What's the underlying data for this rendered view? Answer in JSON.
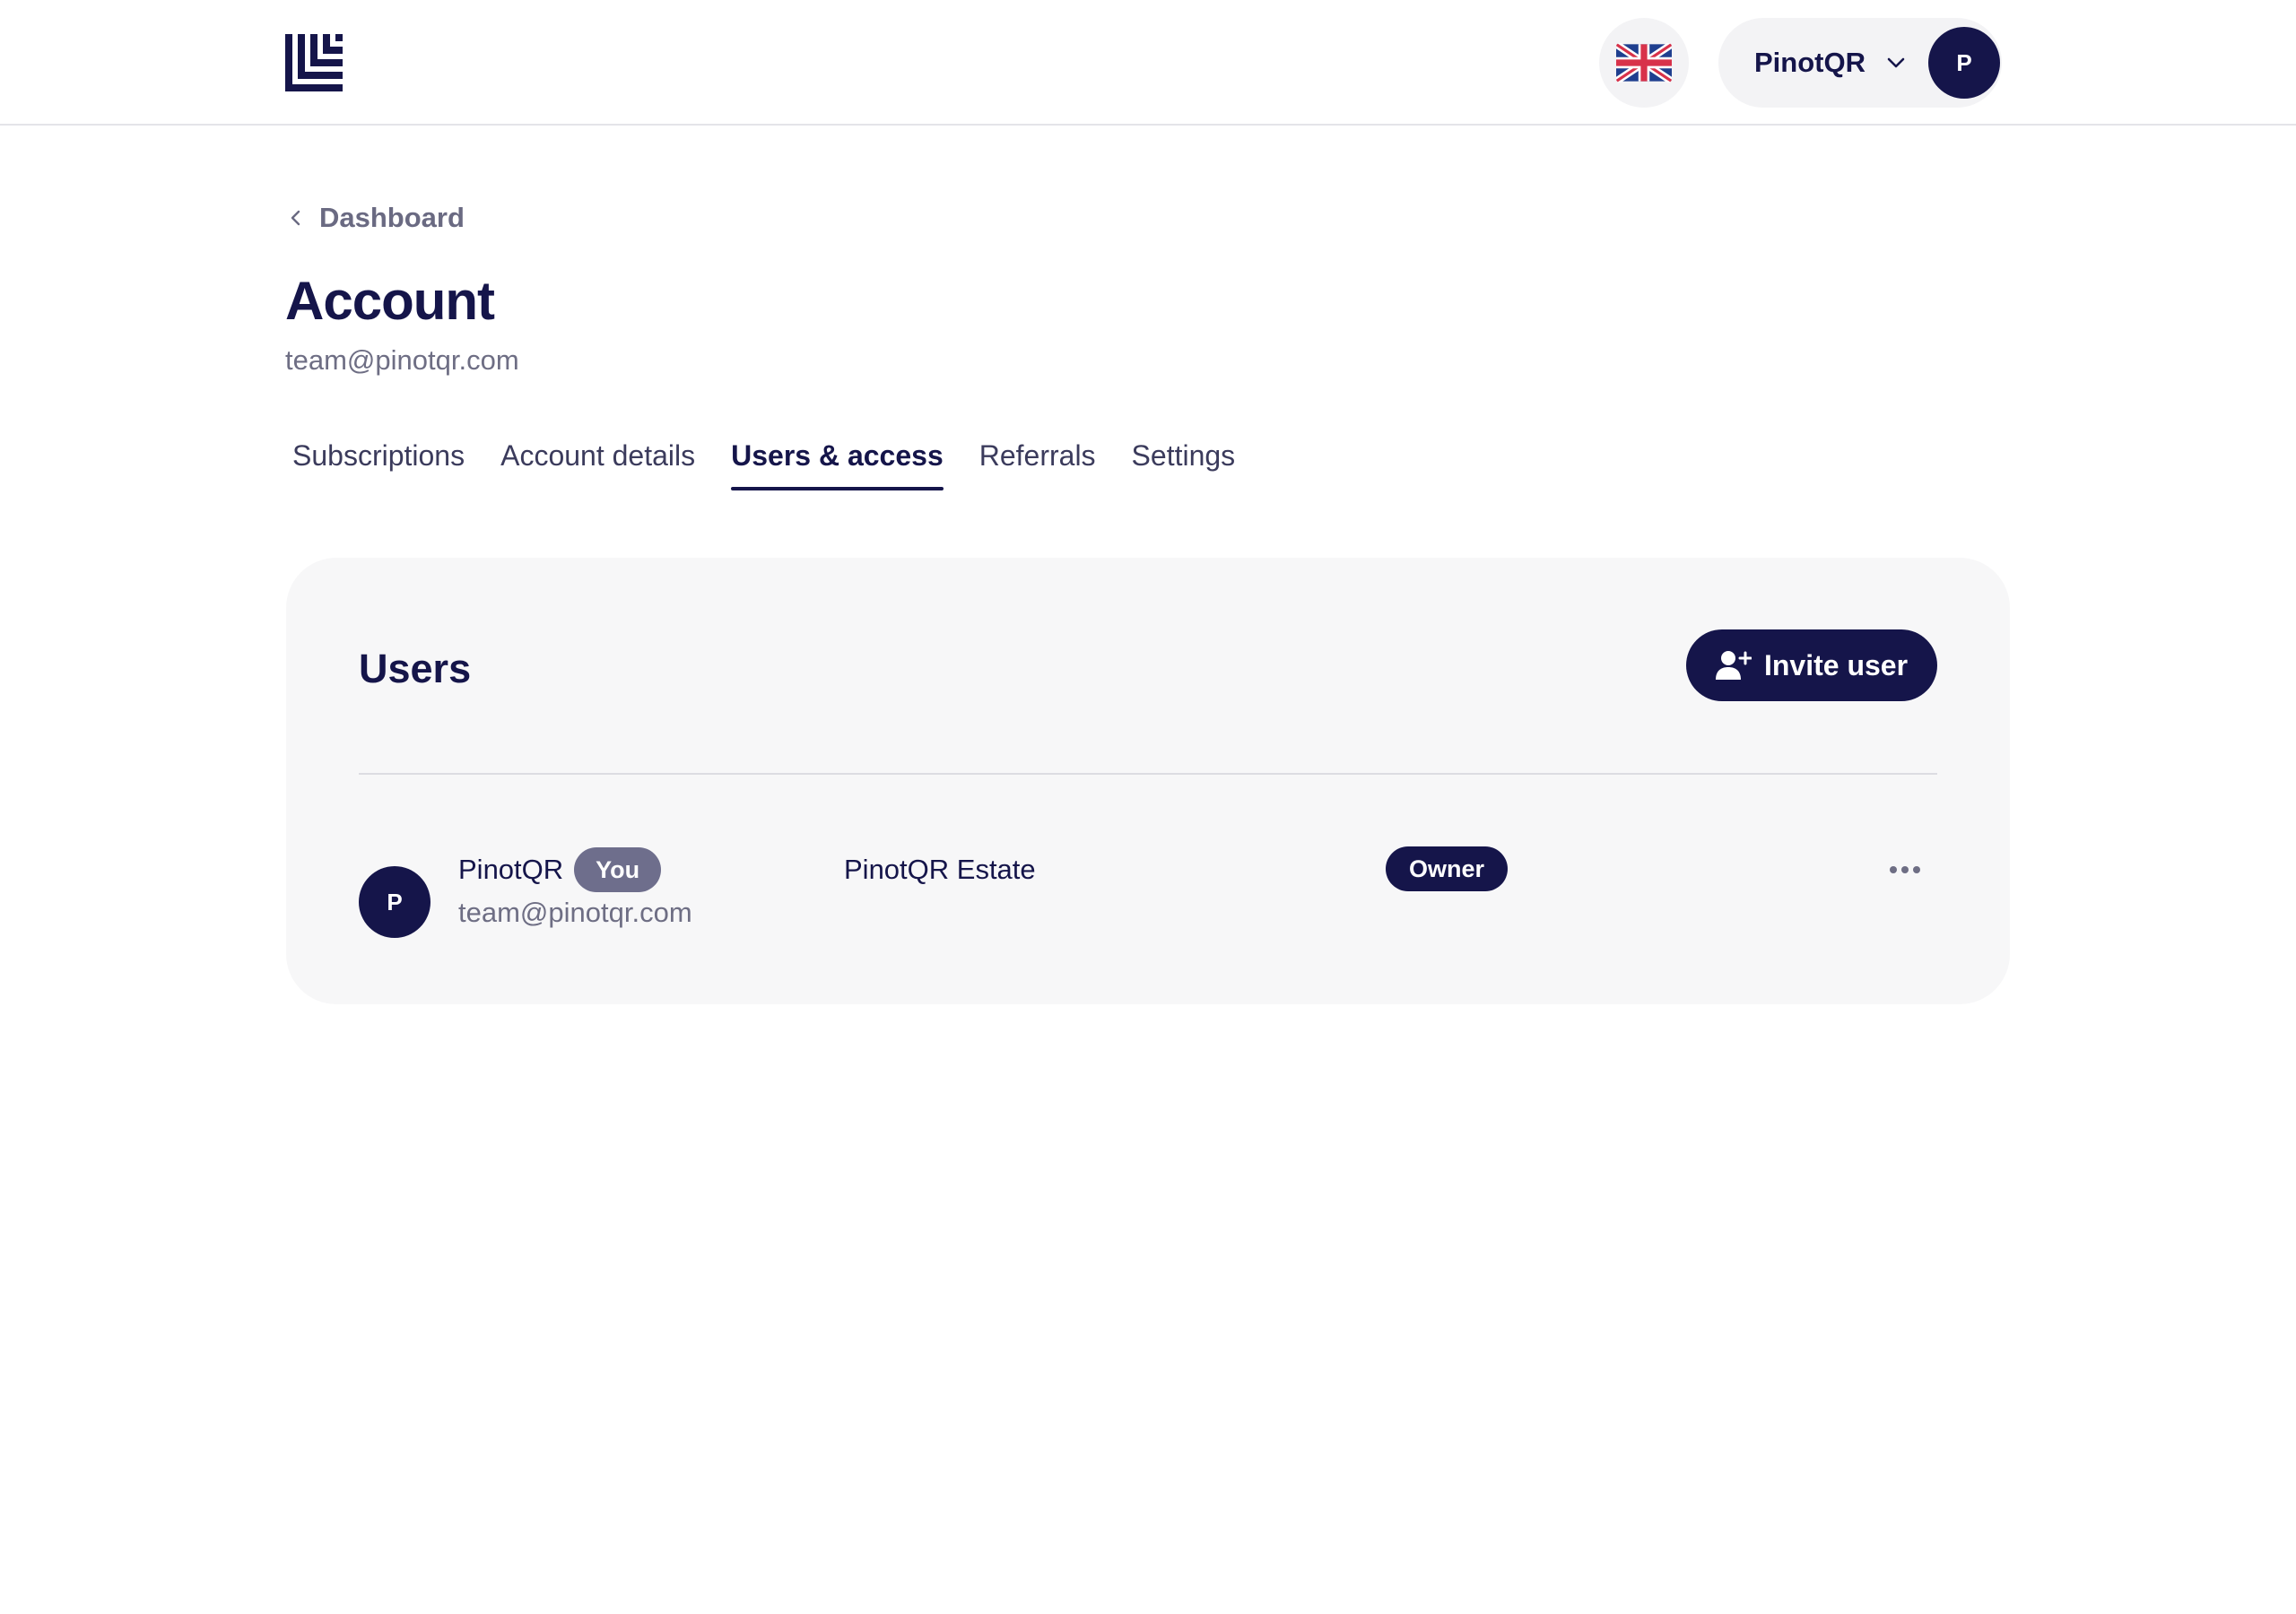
{
  "header": {
    "logo_icon": "brand-logo-icon",
    "language_icon": "uk-flag-icon",
    "account_name": "PinotQR",
    "account_avatar_initial": "P",
    "chevron_icon": "chevron-down-icon"
  },
  "breadcrumb": {
    "icon": "chevron-left-icon",
    "label": "Dashboard"
  },
  "page": {
    "title": "Account",
    "subtitle": "team@pinotqr.com"
  },
  "tabs": [
    {
      "label": "Subscriptions",
      "active": false
    },
    {
      "label": "Account details",
      "active": false
    },
    {
      "label": "Users & access",
      "active": true
    },
    {
      "label": "Referrals",
      "active": false
    },
    {
      "label": "Settings",
      "active": false
    }
  ],
  "users_card": {
    "title": "Users",
    "invite_button": {
      "label": "Invite user",
      "icon": "user-plus-icon"
    },
    "rows": [
      {
        "avatar_initial": "P",
        "name": "PinotQR",
        "badge": "You",
        "email": "team@pinotqr.com",
        "organization": "PinotQR Estate",
        "role": "Owner",
        "menu_icon": "more-horizontal-icon"
      }
    ]
  },
  "colors": {
    "brand_navy": "#15154a",
    "muted_text": "#6e6e84",
    "card_background": "#f7f7f8",
    "you_badge": "#6e6e8c"
  }
}
